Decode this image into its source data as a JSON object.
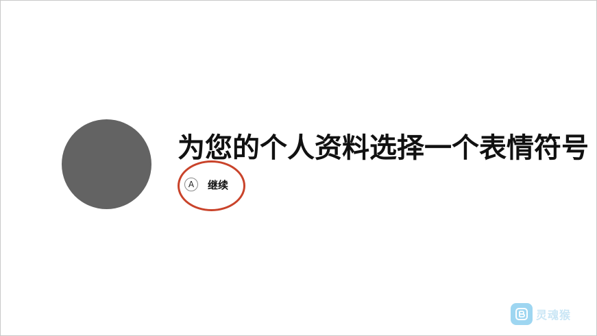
{
  "page": {
    "title": "为您的个人资料选择一个表情符号",
    "continue_button": {
      "glyph": "A",
      "label": "继续"
    }
  },
  "watermark": {
    "text": "灵魂猴"
  },
  "colors": {
    "avatar": "#636363",
    "highlight_ring": "#c9432a",
    "watermark_logo": "#4fb5e6"
  }
}
